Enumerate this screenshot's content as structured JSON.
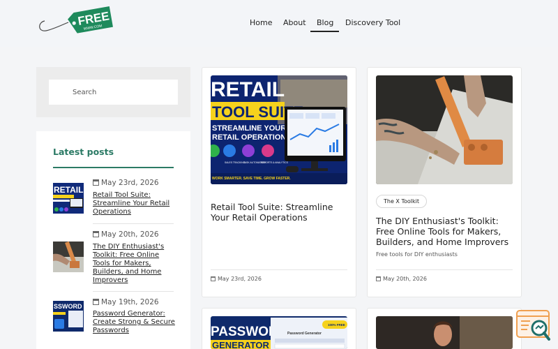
{
  "header": {
    "logo_text": "FREE",
    "logo_subtext": "WWW.COM",
    "nav": [
      {
        "label": "Home"
      },
      {
        "label": "About"
      },
      {
        "label": "Blog"
      },
      {
        "label": "Discovery Tool"
      }
    ],
    "active_nav": "Blog"
  },
  "sidebar": {
    "search_placeholder": "Search",
    "latest_title": "Latest posts",
    "posts": [
      {
        "date": "May 23rd, 2026",
        "title": "Retail Tool Suite: Streamline Your Retail Operations",
        "thumb_text": "RETAIL"
      },
      {
        "date": "May 20th, 2026",
        "title": "The DIY Enthusiast's Toolkit: Free Online Tools for Makers, Builders, and Home Improvers"
      },
      {
        "date": "May 19th, 2026",
        "title": "Password Generator: Create Strong & Secure Passwords",
        "thumb_text": "SSWORD"
      }
    ]
  },
  "cards": [
    {
      "image": {
        "line1": "RETAIL",
        "line2": "TOOL SUITE",
        "line3": "STREAMLINE YOUR",
        "line4": "RETAIL OPERATIONS",
        "footer": "WORK SMARTER. SAVE TIME. GROW FASTER.",
        "icons": [
          "SALES TRACKING",
          "TASK AUTOMATION",
          "REPORTS & ANALYTICS"
        ]
      },
      "title": "Retail Tool Suite: Streamline Your Retail Operations",
      "date": "May 23rd, 2026"
    },
    {
      "tag": "The X Toolkit",
      "title": "The DIY Enthusiast's Toolkit: Free Online Tools for Makers, Builders, and Home Improvers",
      "description": "Free tools for DIY enthusiasts",
      "date": "May 20th, 2026"
    },
    {
      "image": {
        "line1": "PASSWORD",
        "line2": "GENERATOR",
        "panel_title": "Password Generator",
        "badge": "100% FREE"
      }
    },
    {}
  ],
  "colors": {
    "accent_green": "#2b7a65",
    "logo_green": "#1e8a5c",
    "retail_navy": "#102a7a",
    "retail_yellow": "#f6d21c",
    "fab_orange": "#f0a050",
    "fab_teal": "#1f6f6a"
  },
  "icons": [
    "calendar-icon",
    "search-icon",
    "price-tag-logo",
    "search-doc-icon"
  ]
}
